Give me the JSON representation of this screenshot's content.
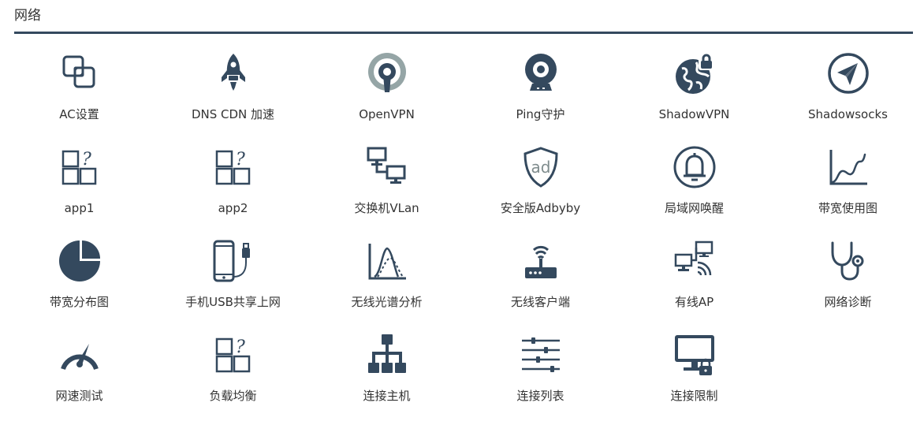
{
  "section": {
    "title": "网络"
  },
  "colors": {
    "icon": "#34495e",
    "icon_grey": "#95a5a6",
    "rule": "#34495e"
  },
  "apps": [
    {
      "label": "AC设置",
      "icon": "overlapping-squares-icon"
    },
    {
      "label": "DNS CDN 加速",
      "icon": "rocket-icon"
    },
    {
      "label": "OpenVPN",
      "icon": "openvpn-icon"
    },
    {
      "label": "Ping守护",
      "icon": "webcam-icon"
    },
    {
      "label": "ShadowVPN",
      "icon": "globe-lock-icon"
    },
    {
      "label": "Shadowsocks",
      "icon": "paper-plane-icon"
    },
    {
      "label": "app1",
      "icon": "unknown-app-icon"
    },
    {
      "label": "app2",
      "icon": "unknown-app-icon"
    },
    {
      "label": "交换机VLan",
      "icon": "network-computers-icon"
    },
    {
      "label": "安全版Adbyby",
      "icon": "ad-shield-icon"
    },
    {
      "label": "局域网唤醒",
      "icon": "bell-icon"
    },
    {
      "label": "带宽使用图",
      "icon": "line-chart-icon"
    },
    {
      "label": "带宽分布图",
      "icon": "pie-chart-icon"
    },
    {
      "label": "手机USB共享上网",
      "icon": "phone-usb-icon"
    },
    {
      "label": "无线光谱分析",
      "icon": "spectrum-icon"
    },
    {
      "label": "无线客户端",
      "icon": "router-icon"
    },
    {
      "label": "有线AP",
      "icon": "wired-ap-icon"
    },
    {
      "label": "网络诊断",
      "icon": "stethoscope-icon"
    },
    {
      "label": "网速测试",
      "icon": "speedometer-icon"
    },
    {
      "label": "负载均衡",
      "icon": "unknown-app-icon"
    },
    {
      "label": "连接主机",
      "icon": "hierarchy-icon"
    },
    {
      "label": "连接列表",
      "icon": "sliders-icon"
    },
    {
      "label": "连接限制",
      "icon": "monitor-lock-icon"
    }
  ]
}
